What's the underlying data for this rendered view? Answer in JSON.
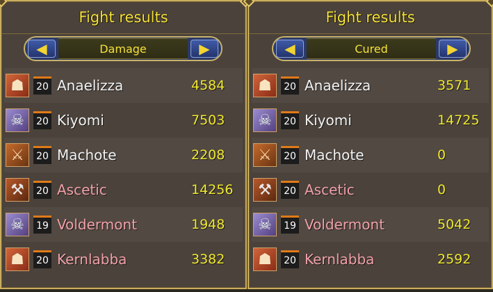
{
  "panels": [
    {
      "title": "Fight results",
      "selector": {
        "label": "Damage",
        "prev_glyph": "◀",
        "next_glyph": "▶"
      },
      "rows": [
        {
          "class_icon": "warrior-portrait",
          "level": "20",
          "name": "Anaelizza",
          "value": "4584",
          "name_color": "white"
        },
        {
          "class_icon": "mage-portrait",
          "level": "20",
          "name": "Kiyomi",
          "value": "7503",
          "name_color": "white"
        },
        {
          "class_icon": "rogue-portrait",
          "level": "20",
          "name": "Machote",
          "value": "2208",
          "name_color": "white"
        },
        {
          "class_icon": "fighter-portrait",
          "level": "20",
          "name": "Ascetic",
          "value": "14256",
          "name_color": "pink"
        },
        {
          "class_icon": "mage-portrait",
          "level": "19",
          "name": "Voldermont",
          "value": "1948",
          "name_color": "pink"
        },
        {
          "class_icon": "warrior-portrait",
          "level": "20",
          "name": "Kernlabba",
          "value": "3382",
          "name_color": "pink"
        }
      ]
    },
    {
      "title": "Fight results",
      "selector": {
        "label": "Cured",
        "prev_glyph": "◀",
        "next_glyph": "▶"
      },
      "rows": [
        {
          "class_icon": "warrior-portrait",
          "level": "20",
          "name": "Anaelizza",
          "value": "3571",
          "name_color": "white"
        },
        {
          "class_icon": "mage-portrait",
          "level": "20",
          "name": "Kiyomi",
          "value": "14725",
          "name_color": "white"
        },
        {
          "class_icon": "rogue-portrait",
          "level": "20",
          "name": "Machote",
          "value": "0",
          "name_color": "white"
        },
        {
          "class_icon": "fighter-portrait",
          "level": "20",
          "name": "Ascetic",
          "value": "0",
          "name_color": "pink"
        },
        {
          "class_icon": "mage-portrait",
          "level": "19",
          "name": "Voldermont",
          "value": "5042",
          "name_color": "pink"
        },
        {
          "class_icon": "warrior-portrait",
          "level": "20",
          "name": "Kernlabba",
          "value": "2592",
          "name_color": "pink"
        }
      ]
    }
  ],
  "colors": {
    "title": "#f4e13a",
    "value": "#f0e830",
    "ally_name": "#f2f2f2",
    "enemy_name": "#f0a0a8",
    "panel_bg": "#4b423b",
    "border_gold": "#c9ad5e"
  }
}
